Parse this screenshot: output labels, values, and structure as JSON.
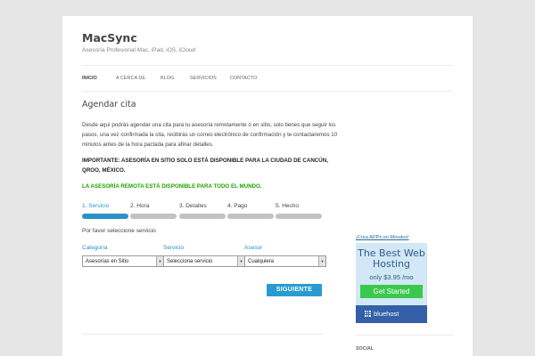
{
  "site": {
    "title": "MacSync",
    "description": "Asesoría Profesional Mac, iPad, iOS, iCloud"
  },
  "nav": {
    "items": [
      {
        "label": "INICIO",
        "active": true
      },
      {
        "label": "A CERCA DE",
        "active": false
      },
      {
        "label": "BLOG",
        "active": false
      },
      {
        "label": "SERVICIOS",
        "active": false
      },
      {
        "label": "CONTACTO",
        "active": false
      }
    ]
  },
  "main": {
    "title": "Agendar cita",
    "intro": "Desde aquí podrás agendar una cita para tu asesoría remotamente ó en sitio, solo tienes que seguir los pasos, una vez confirmada la cita, recibirás un correo electrónico de confirmación y te contactaremos 10 minutos antes de la hora pactada para afinar detalles.",
    "important": "IMPORTANTE: ASESORÍA EN SITIO SOLO ESTÁ DISPONIBLE PARA LA CIUDAD DE CANCÚN, QROO, MÉXICO.",
    "remote_notice": "LA ASESORÍA REMOTA ESTÁ DISPONIBLE PARA TODO EL MUNDO.",
    "steps": [
      {
        "label": "1. Servicio",
        "active": true
      },
      {
        "label": "2. Hora",
        "active": false
      },
      {
        "label": "3. Detalles",
        "active": false
      },
      {
        "label": "4. Pago",
        "active": false
      },
      {
        "label": "5. Hecho",
        "active": false
      }
    ],
    "select_prompt": "Por favor seleccione servicio",
    "fields": {
      "category": {
        "label": "Categoría",
        "value": "Asesorías en Sitio"
      },
      "service": {
        "label": "Servicio",
        "value": "Selecciona servicio"
      },
      "advisor": {
        "label": "Asesor",
        "value": "Cualquiera"
      }
    },
    "next_button": "SIGUIENTE"
  },
  "sidebar": {
    "ad_link": "¡Crea APPs en Minutos!",
    "ad": {
      "title": "The Best Web Hosting",
      "price": "only $3.95 /mo",
      "button": "Get Started",
      "brand": "bluehost"
    },
    "social_label": "SOCIAL"
  },
  "colors": {
    "accent": "#2a91c9",
    "remote_green": "#21a200",
    "ad_background": "#d3e8f6",
    "ad_button": "#3ac94c",
    "ad_footer": "#3360a8"
  }
}
